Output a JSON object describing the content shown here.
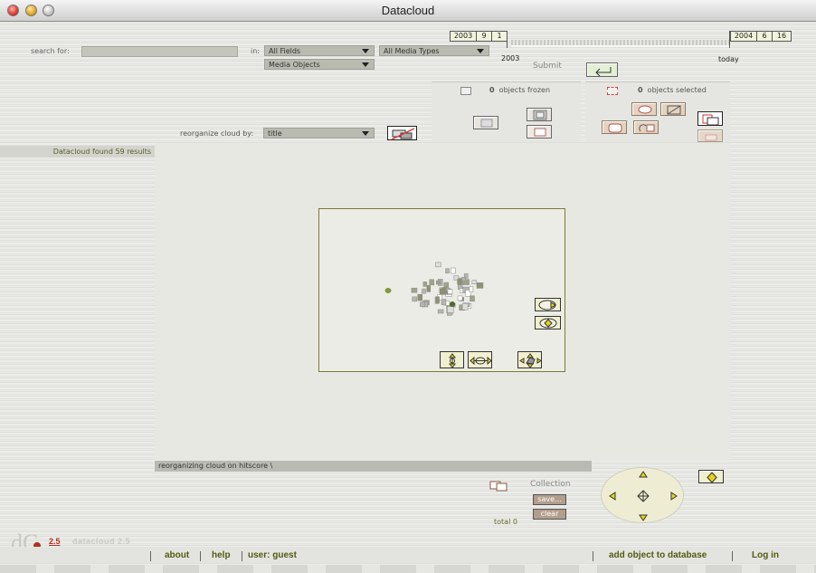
{
  "window": {
    "title": "Datacloud"
  },
  "search": {
    "label": "search for:",
    "value": "",
    "in_label": "in:",
    "field_select": "All Fields",
    "mediatype_select": "All Media Types",
    "object_select": "Media Objects",
    "submit_label": "Submit"
  },
  "timeline": {
    "start": {
      "year": "2003",
      "month": "9",
      "day": "1"
    },
    "start_label": "2003",
    "end": {
      "year": "2004",
      "month": "6",
      "day": "16"
    },
    "end_label": "today"
  },
  "frozen": {
    "count": "0",
    "label": "objects frozen"
  },
  "selected": {
    "count": "0",
    "label": "objects selected"
  },
  "reorganize": {
    "label": "reorganize cloud by:",
    "value": "title"
  },
  "results": {
    "text": "Datacloud found 59 results"
  },
  "status": {
    "text": "reorganizing cloud on hitscore \\"
  },
  "collection": {
    "label": "Collection",
    "save_label": "save...",
    "clear_label": "clear",
    "total_label": "total 0"
  },
  "logo": {
    "version": "2.5",
    "name": "datacloud 2.5"
  },
  "footer": {
    "about": "about",
    "help": "help",
    "user": "user: guest",
    "add": "add object to database",
    "login": "Log in"
  },
  "colors": {
    "accent": "#7b7a34",
    "viewport_bg": "#ecece6",
    "link": "#555a10",
    "button_tan": "#b39d8d"
  }
}
